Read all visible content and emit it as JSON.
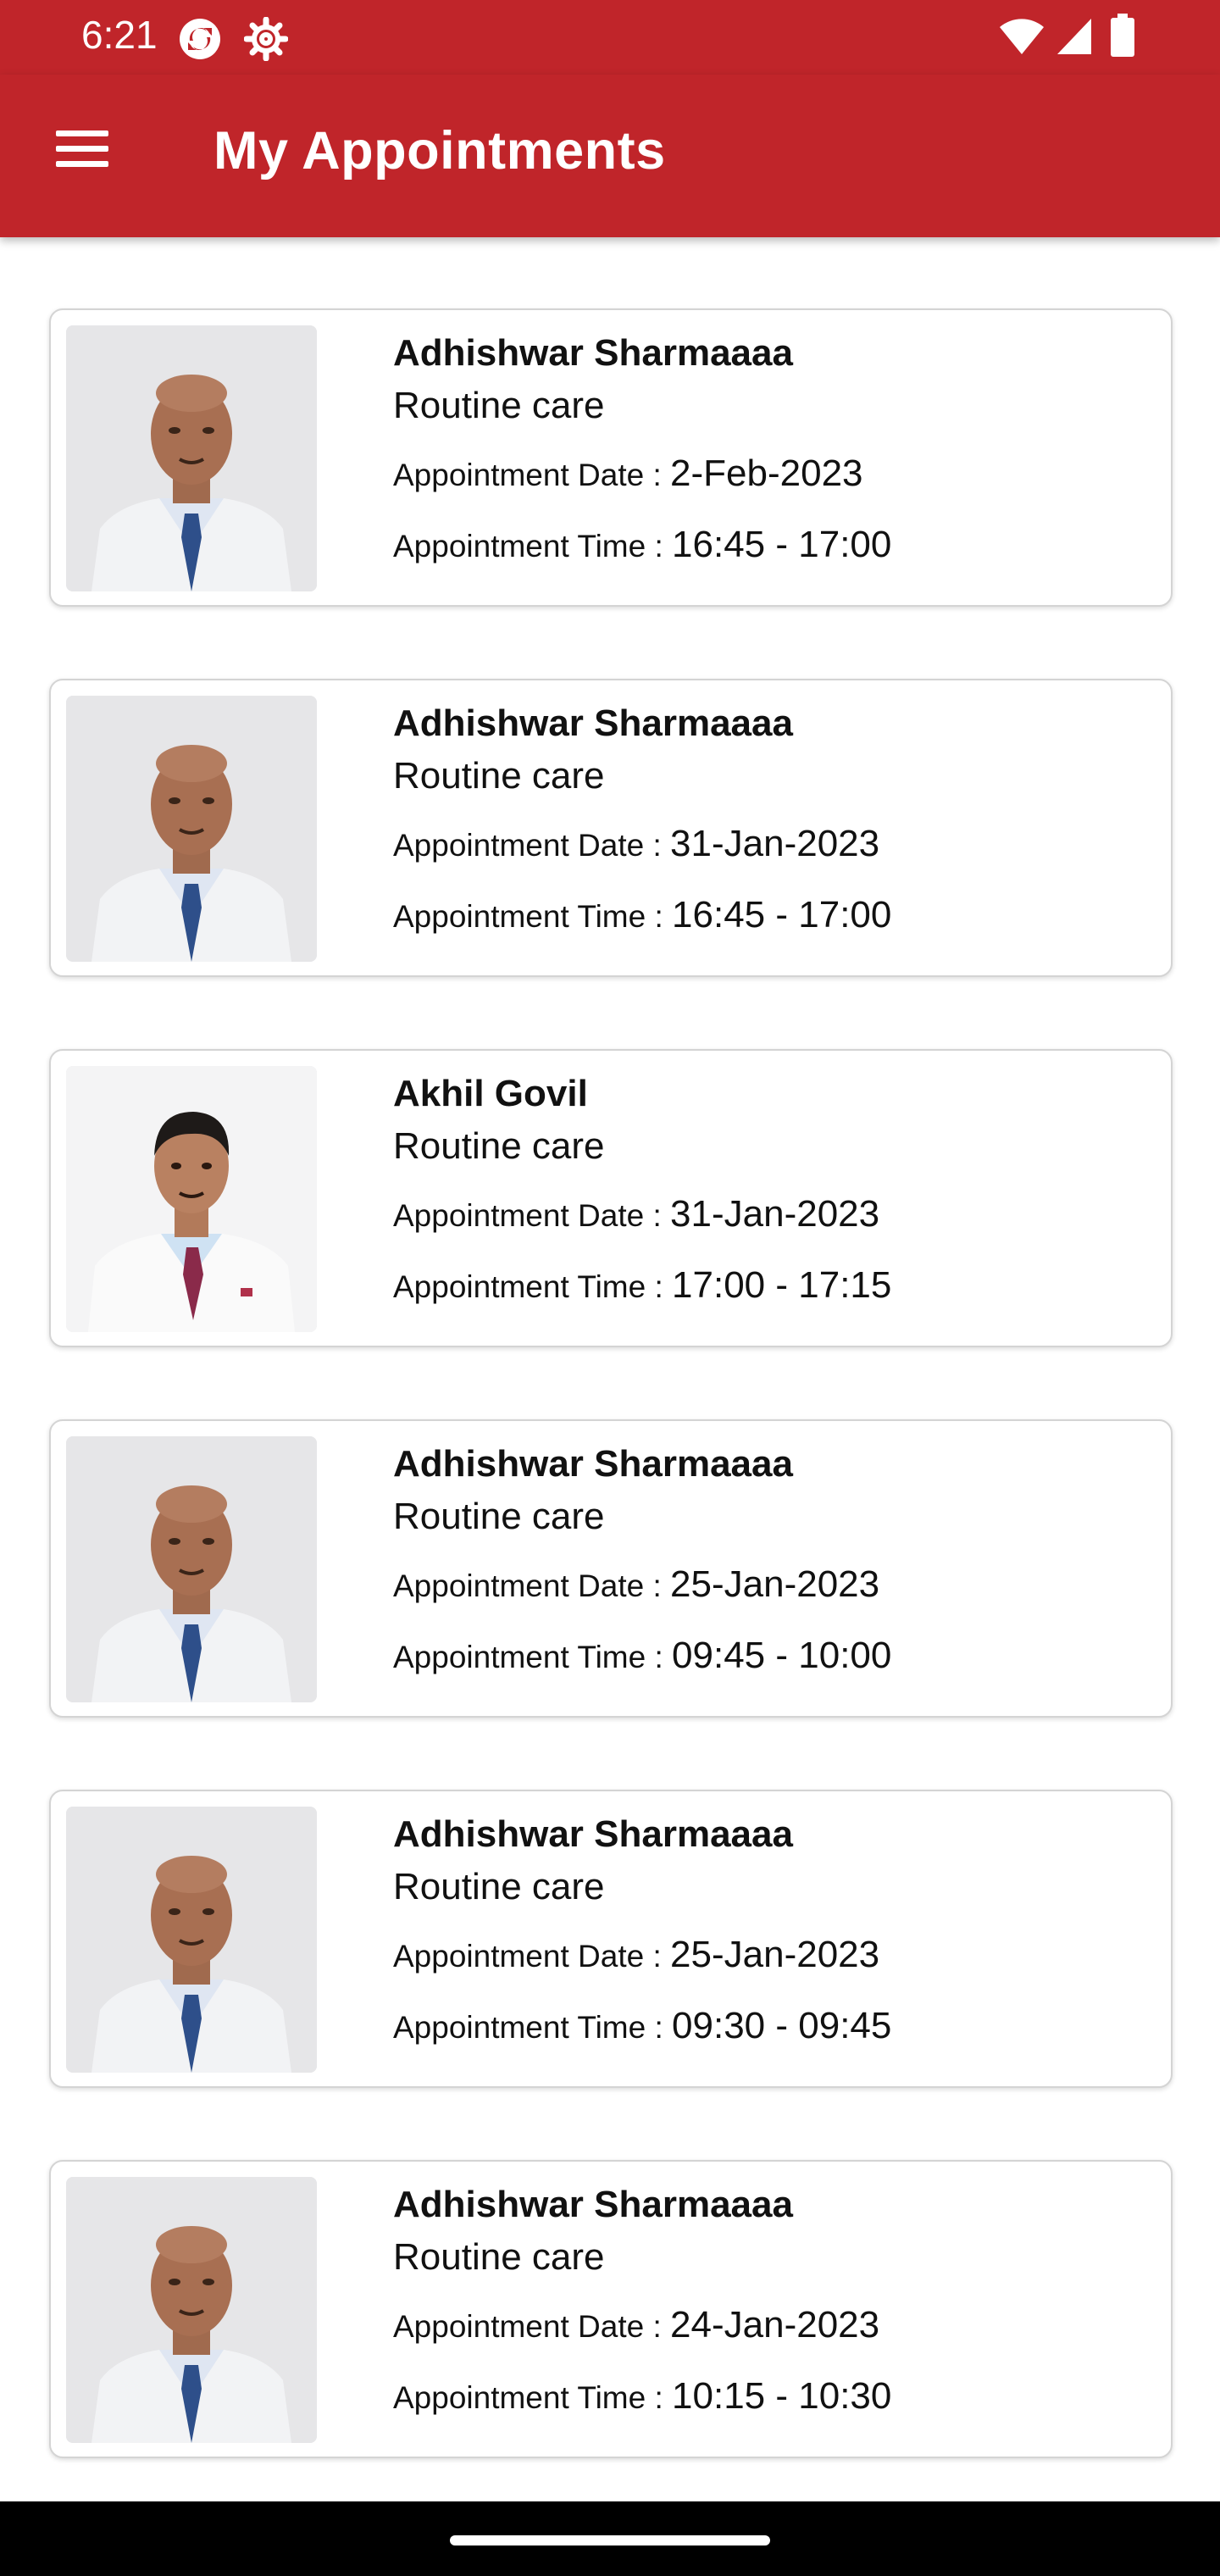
{
  "status_bar": {
    "time": "6:21",
    "left_icons": [
      "sync-icon",
      "settings-gear-icon"
    ],
    "right_icons": [
      "wifi-icon",
      "cellular-signal-icon",
      "battery-icon"
    ]
  },
  "app_bar": {
    "title": "My Appointments",
    "menu_icon": "hamburger-menu-icon",
    "color": "#c0252a"
  },
  "labels": {
    "date": "Appointment Date : ",
    "time": "Appointment Time : "
  },
  "appointments": [
    {
      "doctor": "Adhishwar Sharmaaaa",
      "type": "Routine care",
      "date": "2-Feb-2023",
      "time": "16:45 - 17:00",
      "photo": "doctor-photo-adhishwar"
    },
    {
      "doctor": "Adhishwar Sharmaaaa",
      "type": "Routine care",
      "date": "31-Jan-2023",
      "time": "16:45 - 17:00",
      "photo": "doctor-photo-adhishwar"
    },
    {
      "doctor": "Akhil Govil",
      "type": "Routine care",
      "date": "31-Jan-2023",
      "time": "17:00 - 17:15",
      "photo": "doctor-photo-akhil"
    },
    {
      "doctor": "Adhishwar Sharmaaaa",
      "type": "Routine care",
      "date": "25-Jan-2023",
      "time": "09:45 - 10:00",
      "photo": "doctor-photo-adhishwar"
    },
    {
      "doctor": "Adhishwar Sharmaaaa",
      "type": "Routine care",
      "date": "25-Jan-2023",
      "time": "09:30 - 09:45",
      "photo": "doctor-photo-adhishwar"
    },
    {
      "doctor": "Adhishwar Sharmaaaa",
      "type": "Routine care",
      "date": "24-Jan-2023",
      "time": "10:15 - 10:30",
      "photo": "doctor-photo-adhishwar"
    }
  ]
}
